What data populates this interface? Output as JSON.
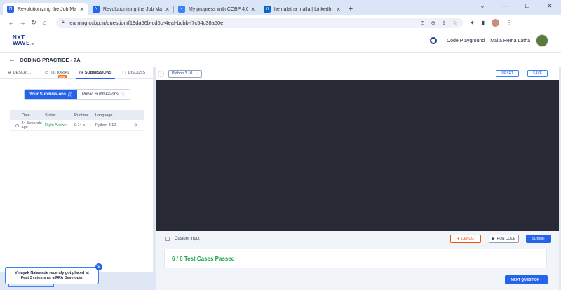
{
  "browser": {
    "tabs": [
      {
        "title": "Revolutionizing the Job Market |",
        "fav_color": "#2563eb",
        "active": true
      },
      {
        "title": "Revolutionizing the Job Market |",
        "fav_color": "#2563eb",
        "active": false
      },
      {
        "title": "My progress with CCBP 4.0 Acad",
        "fav_color": "#3b82f6",
        "active": false
      },
      {
        "title": "hemalatha malla | LinkedIn",
        "fav_color": "#0a66c2",
        "active": false
      }
    ],
    "url": "learning.ccbp.in/question/f19da66b-cd5b-4eaf-bcbb-f7c54c38a50e"
  },
  "header": {
    "logo_line1": "NXT",
    "logo_line2": "WAVE",
    "code_playground": "Code Playground",
    "user_name": "Malla Hema Latha"
  },
  "breadcrumb": {
    "title": "CODING PRACTICE - 7A"
  },
  "left_tabs": [
    {
      "label": "DESCRI..."
    },
    {
      "label": "TUTORIAL",
      "badge": "New"
    },
    {
      "label": "SUBMISSIONS"
    },
    {
      "label": "DISCUSS"
    }
  ],
  "submissions": {
    "your": "Your Submissions",
    "public": "Public Submissions",
    "columns": [
      "Date",
      "Status",
      "Runtime",
      "Language"
    ],
    "rows": [
      {
        "date": "24 Seconds ago",
        "status": "Right Answer",
        "runtime": "0.14 s",
        "language": "Python 3.10"
      }
    ]
  },
  "editor": {
    "language": "Python 3.10",
    "reset": "RESET",
    "save": "SAVE"
  },
  "controls": {
    "custom_input": "Custom Input",
    "debug": "DEBUG",
    "run_code": "RUN CODE",
    "submit": "SUBMIT"
  },
  "result": {
    "text": "6 / 6 Test Cases Passed"
  },
  "next_question": "NEXT QUESTION",
  "toast": {
    "line1": "Vinayak Nalawade recently got placed at",
    "line2": "Feat Systems as a RPA Developer"
  },
  "colors": {
    "accent": "#2563eb",
    "success": "#16a34a",
    "debug": "#ea580c",
    "editor_bg": "#272934"
  }
}
